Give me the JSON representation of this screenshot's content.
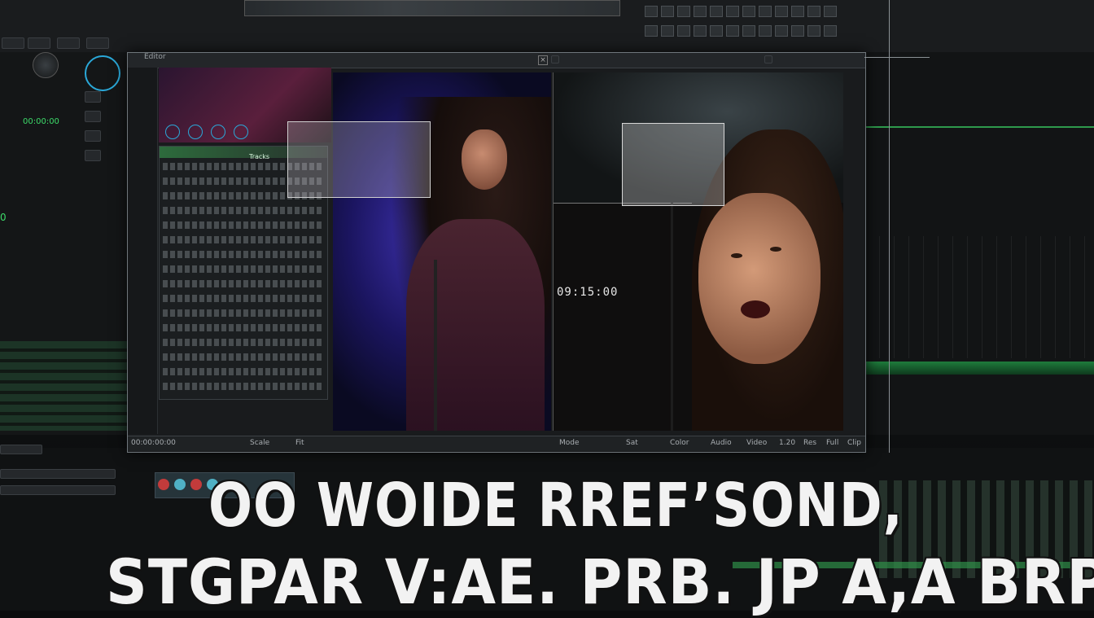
{
  "editor": {
    "window_title": "Editor",
    "counter_overlay": "09:15:00",
    "status_segments": [
      "00:00:00:00",
      "Scale",
      "Fit",
      "Mode",
      "Sat",
      "Color",
      "Audio",
      "Video",
      "1.20",
      "Res",
      "Full",
      "Clip"
    ]
  },
  "track_list": {
    "header_label": "Tracks"
  },
  "left_panel": {
    "timecode": "0",
    "readout": "00:00:00"
  },
  "caption": {
    "line1": "OO WOIDE RREF’SOND,",
    "line2": "STGPAR V:AE. PRB. JP A,A BRP"
  },
  "colors": {
    "accent_green": "#3ddc6a",
    "frame_border": "#6f767b",
    "stage_blue": "#3b2fa8"
  }
}
